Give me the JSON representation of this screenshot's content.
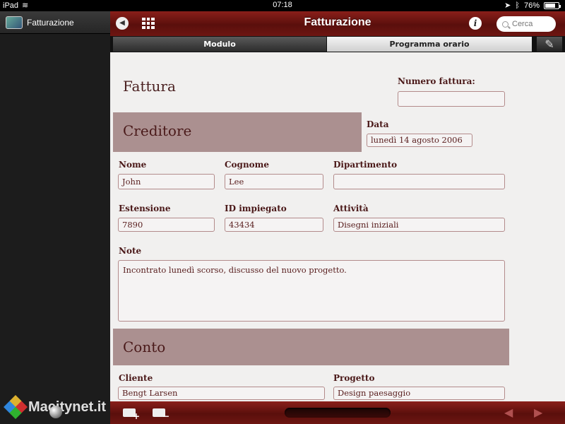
{
  "status": {
    "device": "iPad",
    "time": "07:18",
    "battery": "76%",
    "battery_level": 0.76
  },
  "sidebar": {
    "items": [
      {
        "label": "Fatturazione",
        "icon": "app-icon"
      }
    ],
    "watermark": "Macitynet.it"
  },
  "nav": {
    "title": "Fatturazione",
    "search_placeholder": "Cerca"
  },
  "tabs": [
    {
      "label": "Modulo",
      "selected": true
    },
    {
      "label": "Programma orario",
      "selected": false
    }
  ],
  "form": {
    "title": "Fattura",
    "invoice_number_label": "Numero fattura:",
    "invoice_number_value": "",
    "creditor_section": "Creditore",
    "date_label": "Data",
    "date_value": "lunedì 14 agosto 2006",
    "fields": {
      "nome": {
        "label": "Nome",
        "value": "John"
      },
      "cognome": {
        "label": "Cognome",
        "value": "Lee"
      },
      "dipartimento": {
        "label": "Dipartimento",
        "value": ""
      },
      "estensione": {
        "label": "Estensione",
        "value": "7890"
      },
      "id_impiegato": {
        "label": "ID impiegato",
        "value": "43434"
      },
      "attivita": {
        "label": "Attività",
        "value": "Disegni iniziali"
      }
    },
    "notes_label": "Note",
    "notes_value": "Incontrato lunedì scorso, discusso del nuovo progetto.",
    "account_section": "Conto",
    "cliente": {
      "label": "Cliente",
      "value": "Bengt Larsen"
    },
    "progetto": {
      "label": "Progetto",
      "value": "Design paesaggio"
    }
  },
  "colors": {
    "bar_red": "#6e1612",
    "section_bg": "#ab9090",
    "label_text": "#4a1818"
  }
}
